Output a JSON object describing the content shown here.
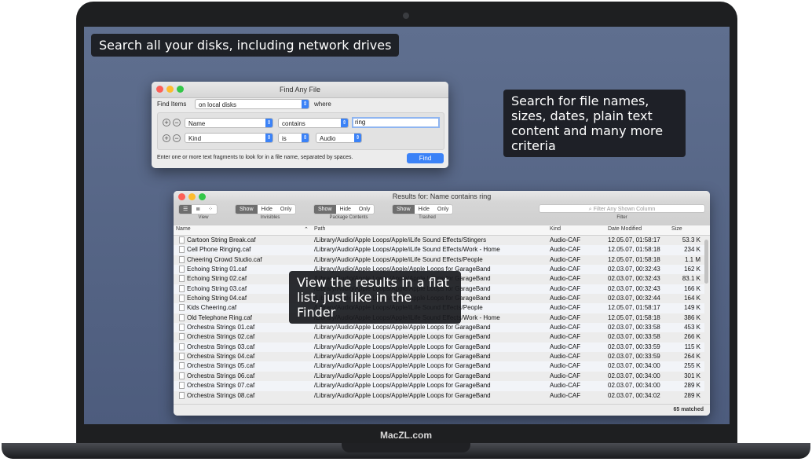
{
  "brand": "MacZL.com",
  "tips": {
    "t1": "Search all your disks, including network drives",
    "t2": "Search for file names, sizes, dates, plain text content and many more criteria",
    "t3": "View the results in a flat list, just like in the Finder"
  },
  "find_window": {
    "title": "Find Any File",
    "find_items": "Find Items",
    "location": "on local disks",
    "where": "where",
    "crit1": {
      "attr": "Name",
      "op": "contains",
      "value": "ring"
    },
    "crit2": {
      "attr": "Kind",
      "op": "is",
      "value": "Audio"
    },
    "hint": "Enter one or more text fragments to look for in a file name, separated by spaces.",
    "find_button": "Find",
    "plus": "+",
    "minus": "−"
  },
  "results_window": {
    "title": "Results for: Name contains ring",
    "seg": {
      "show": "Show",
      "hide": "Hide",
      "only": "Only"
    },
    "captions": {
      "view": "View",
      "invisibles": "Invisibles",
      "package": "Package Contents",
      "trashed": "Trashed",
      "filter": "Filter"
    },
    "filter_placeholder": "Filter Any Shown Column",
    "columns": {
      "name": "Name",
      "path": "Path",
      "kind": "Kind",
      "date": "Date Modified",
      "size": "Size"
    },
    "rows": [
      {
        "name": "Cartoon String Break.caf",
        "path": "/Library/Audio/Apple Loops/Apple/iLife Sound Effects/Stingers",
        "kind": "Audio-CAF",
        "date": "12.05.07, 01:58:17",
        "size": "53.3 K"
      },
      {
        "name": "Cell Phone Ringing.caf",
        "path": "/Library/Audio/Apple Loops/Apple/iLife Sound Effects/Work - Home",
        "kind": "Audio-CAF",
        "date": "12.05.07, 01:58:18",
        "size": "234 K"
      },
      {
        "name": "Cheering Crowd Studio.caf",
        "path": "/Library/Audio/Apple Loops/Apple/iLife Sound Effects/People",
        "kind": "Audio-CAF",
        "date": "12.05.07, 01:58:18",
        "size": "1.1 M"
      },
      {
        "name": "Echoing String 01.caf",
        "path": "/Library/Audio/Apple Loops/Apple/Apple Loops for GarageBand",
        "kind": "Audio-CAF",
        "date": "02.03.07, 00:32:43",
        "size": "162 K"
      },
      {
        "name": "Echoing String 02.caf",
        "path": "/Library/Audio/Apple Loops/Apple/Apple Loops for GarageBand",
        "kind": "Audio-CAF",
        "date": "02.03.07, 00:32:43",
        "size": "83.1 K"
      },
      {
        "name": "Echoing String 03.caf",
        "path": "/Library/Audio/Apple Loops/Apple/Apple Loops for GarageBand",
        "kind": "Audio-CAF",
        "date": "02.03.07, 00:32:43",
        "size": "166 K"
      },
      {
        "name": "Echoing String 04.caf",
        "path": "/Library/Audio/Apple Loops/Apple/Apple Loops for GarageBand",
        "kind": "Audio-CAF",
        "date": "02.03.07, 00:32:44",
        "size": "164 K"
      },
      {
        "name": "Kids Cheering.caf",
        "path": "/Library/Audio/Apple Loops/Apple/iLife Sound Effects/People",
        "kind": "Audio-CAF",
        "date": "12.05.07, 01:58:17",
        "size": "149 K"
      },
      {
        "name": "Old Telephone Ring.caf",
        "path": "/Library/Audio/Apple Loops/Apple/iLife Sound Effects/Work - Home",
        "kind": "Audio-CAF",
        "date": "12.05.07, 01:58:18",
        "size": "386 K"
      },
      {
        "name": "Orchestra Strings 01.caf",
        "path": "/Library/Audio/Apple Loops/Apple/Apple Loops for GarageBand",
        "kind": "Audio-CAF",
        "date": "02.03.07, 00:33:58",
        "size": "453 K"
      },
      {
        "name": "Orchestra Strings 02.caf",
        "path": "/Library/Audio/Apple Loops/Apple/Apple Loops for GarageBand",
        "kind": "Audio-CAF",
        "date": "02.03.07, 00:33:58",
        "size": "266 K"
      },
      {
        "name": "Orchestra Strings 03.caf",
        "path": "/Library/Audio/Apple Loops/Apple/Apple Loops for GarageBand",
        "kind": "Audio-CAF",
        "date": "02.03.07, 00:33:59",
        "size": "115 K"
      },
      {
        "name": "Orchestra Strings 04.caf",
        "path": "/Library/Audio/Apple Loops/Apple/Apple Loops for GarageBand",
        "kind": "Audio-CAF",
        "date": "02.03.07, 00:33:59",
        "size": "264 K"
      },
      {
        "name": "Orchestra Strings 05.caf",
        "path": "/Library/Audio/Apple Loops/Apple/Apple Loops for GarageBand",
        "kind": "Audio-CAF",
        "date": "02.03.07, 00:34:00",
        "size": "255 K"
      },
      {
        "name": "Orchestra Strings 06.caf",
        "path": "/Library/Audio/Apple Loops/Apple/Apple Loops for GarageBand",
        "kind": "Audio-CAF",
        "date": "02.03.07, 00:34:00",
        "size": "301 K"
      },
      {
        "name": "Orchestra Strings 07.caf",
        "path": "/Library/Audio/Apple Loops/Apple/Apple Loops for GarageBand",
        "kind": "Audio-CAF",
        "date": "02.03.07, 00:34:00",
        "size": "289 K"
      },
      {
        "name": "Orchestra Strings 08.caf",
        "path": "/Library/Audio/Apple Loops/Apple/Apple Loops for GarageBand",
        "kind": "Audio-CAF",
        "date": "02.03.07, 00:34:02",
        "size": "289 K"
      }
    ],
    "status": "65 matched"
  }
}
